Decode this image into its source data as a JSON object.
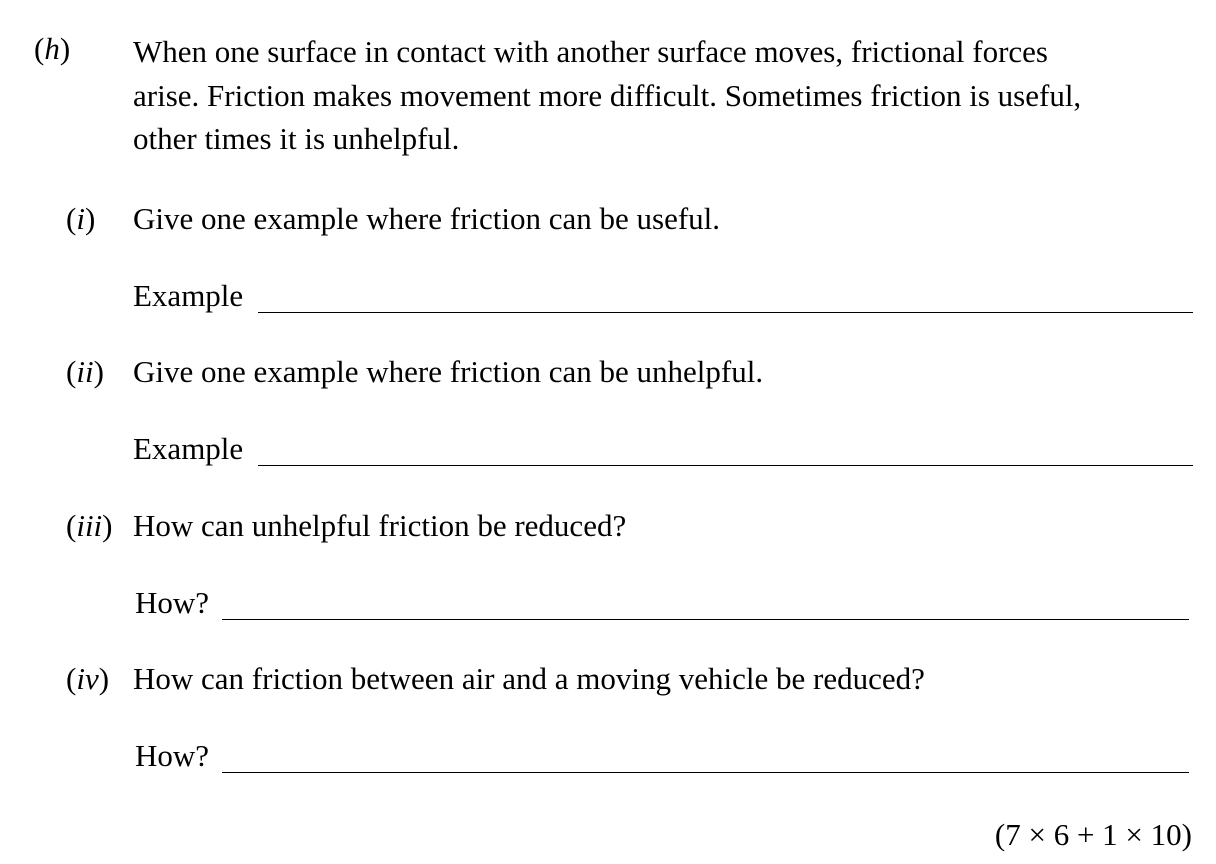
{
  "question": {
    "label": "h",
    "intro_lines": [
      "When one surface in contact with another surface moves, frictional forces",
      "arise. Friction makes movement more difficult. Sometimes friction is useful,",
      "other times it is unhelpful."
    ],
    "parts": [
      {
        "label": "i",
        "prompt": "Give one example where friction can be useful.",
        "answer_label": "Example",
        "answer_value": ""
      },
      {
        "label": "ii",
        "prompt": "Give one example where friction can be unhelpful.",
        "answer_label": "Example",
        "answer_value": ""
      },
      {
        "label": "iii",
        "prompt": "How can unhelpful friction be reduced?",
        "answer_label": "How?",
        "answer_value": ""
      },
      {
        "label": "iv",
        "prompt": "How can friction between air and a moving vehicle be reduced?",
        "answer_label": "How?",
        "answer_value": ""
      }
    ],
    "marks": "(7 × 6 + 1 × 10)"
  }
}
